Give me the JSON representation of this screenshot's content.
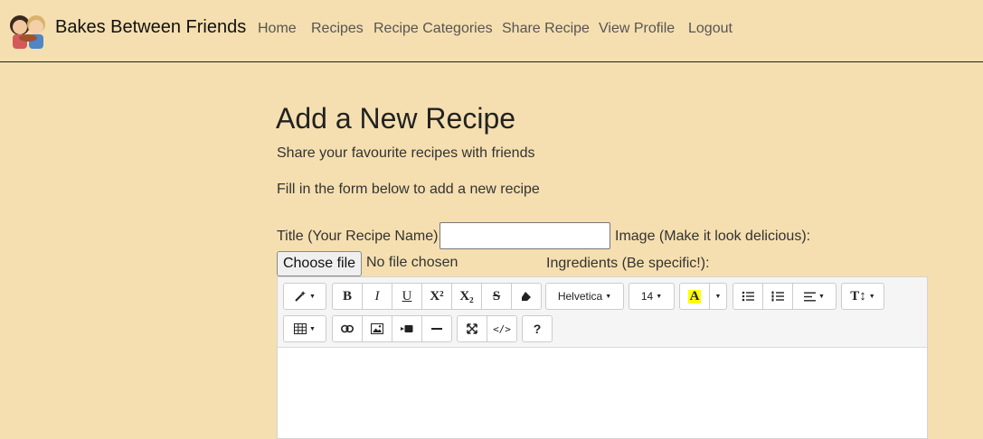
{
  "navbar": {
    "brand": "Bakes Between Friends",
    "items": [
      "Home",
      "Recipes",
      "Recipe Categories",
      "Share Recipe",
      "View Profile",
      "Logout"
    ]
  },
  "main": {
    "title": "Add a New Recipe",
    "subtitle": "Share your favourite recipes with friends",
    "instructions": "Fill in the form below to add a new recipe"
  },
  "form": {
    "title_label": "Title (Your Recipe Name):",
    "title_value": "",
    "image_label": "Image (Make it look delicious):",
    "file_button": "Choose file",
    "file_status": "No file chosen",
    "ingredients_label": "Ingredients (Be specific!):"
  },
  "toolbar": {
    "bold": "B",
    "italic": "I",
    "underline": "U",
    "superscript": "X²",
    "subscript": "X₂",
    "strikethrough": "S",
    "font_name": "Helvetica",
    "font_size": "14",
    "color_letter": "A",
    "help": "?",
    "code": "</>"
  },
  "colors": {
    "background": "#f5dfb0",
    "highlight": "#ffff00"
  }
}
